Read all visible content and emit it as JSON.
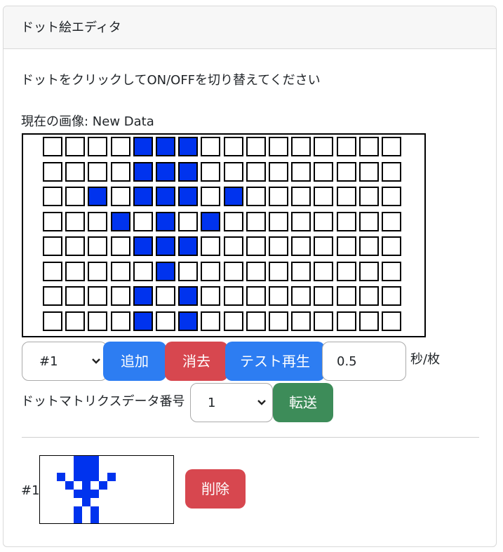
{
  "header": {
    "title": "ドット絵エディタ"
  },
  "instruction": "ドットをクリックしてON/OFFを切り替えてください",
  "current_image_label": "現在の画像: New Data",
  "editor": {
    "rows": 8,
    "cols": 16,
    "on_color": "#0033ee",
    "off_color": "#ffffff",
    "pixels": [
      "0000111000000000",
      "0000111000000000",
      "0010111010000000",
      "0001010100000000",
      "0000111000000000",
      "0000010000000000",
      "0000101000000000",
      "0000101000000000"
    ]
  },
  "controls": {
    "frame_select_value": "#1",
    "add_label": "追加",
    "erase_label": "消去",
    "test_play_label": "テスト再生",
    "interval_value": "0.5",
    "interval_unit": "秒/枚",
    "matrix_number_label": "ドットマトリクスデータ番号",
    "matrix_number_value": "1",
    "send_label": "転送"
  },
  "frames": [
    {
      "index_label": "#1",
      "delete_label": "削除"
    }
  ],
  "colors": {
    "primary": "#2d7df2",
    "danger": "#d7474f",
    "success": "#3d8c59"
  }
}
